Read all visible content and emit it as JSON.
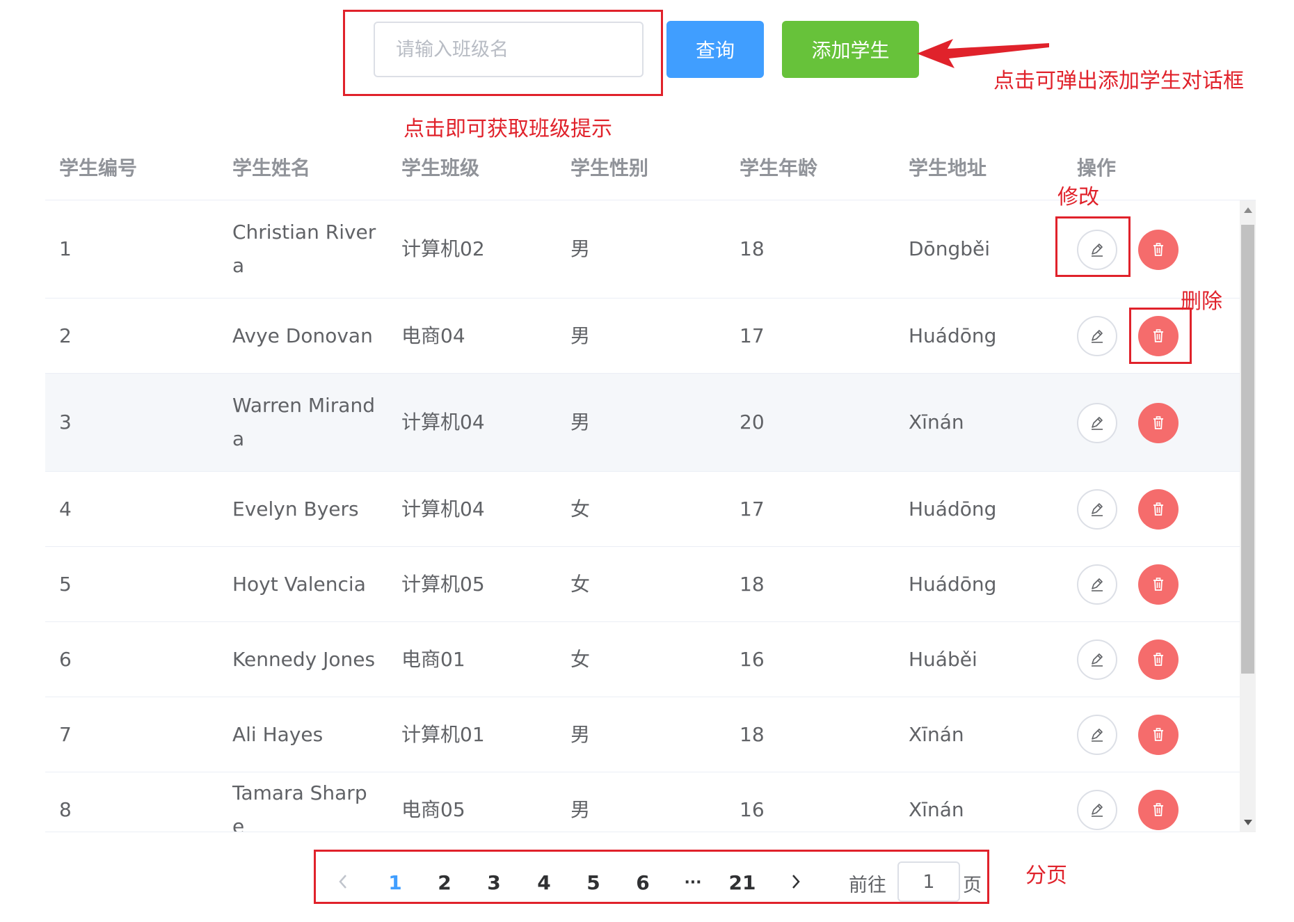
{
  "search": {
    "placeholder": "请输入班级名"
  },
  "buttons": {
    "query": "查询",
    "add_student": "添加学生"
  },
  "annotations": {
    "add_dialog_hint": "点击可弹出添加学生对话框",
    "class_hint": "点击即可获取班级提示",
    "edit_label": "修改",
    "delete_label": "删除",
    "pagination_label": "分页"
  },
  "table": {
    "columns": [
      "学生编号",
      "学生姓名",
      "学生班级",
      "学生性别",
      "学生年龄",
      "学生地址",
      "操作"
    ],
    "rows": [
      {
        "id": "1",
        "name": "Christian Rivera",
        "class": "计算机02",
        "gender": "男",
        "age": "18",
        "address": "Dōngběi"
      },
      {
        "id": "2",
        "name": "Avye Donovan",
        "class": "电商04",
        "gender": "男",
        "age": "17",
        "address": "Huádōng"
      },
      {
        "id": "3",
        "name": "Warren Miranda",
        "class": "计算机04",
        "gender": "男",
        "age": "20",
        "address": "Xīnán"
      },
      {
        "id": "4",
        "name": "Evelyn Byers",
        "class": "计算机04",
        "gender": "女",
        "age": "17",
        "address": "Huádōng"
      },
      {
        "id": "5",
        "name": "Hoyt Valencia",
        "class": "计算机05",
        "gender": "女",
        "age": "18",
        "address": "Huádōng"
      },
      {
        "id": "6",
        "name": "Kennedy Jones",
        "class": "电商01",
        "gender": "女",
        "age": "16",
        "address": "Huáběi"
      },
      {
        "id": "7",
        "name": "Ali Hayes",
        "class": "计算机01",
        "gender": "男",
        "age": "18",
        "address": "Xīnán"
      },
      {
        "id": "8",
        "name": "Tamara Sharpe",
        "class": "电商05",
        "gender": "男",
        "age": "16",
        "address": "Xīnán"
      }
    ]
  },
  "pagination": {
    "pages": [
      "1",
      "2",
      "3",
      "4",
      "5",
      "6",
      "···",
      "21"
    ],
    "current": "1",
    "goto_prefix": "前往",
    "goto_value": "1",
    "goto_suffix": "页"
  },
  "colors": {
    "primary": "#409eff",
    "success": "#67c23a",
    "danger": "#f56c6c",
    "annotation": "#e0222b"
  },
  "icons": {
    "edit": "pencil-icon",
    "delete": "trash-icon",
    "prev": "chevron-left-icon",
    "next": "chevron-right-icon"
  }
}
